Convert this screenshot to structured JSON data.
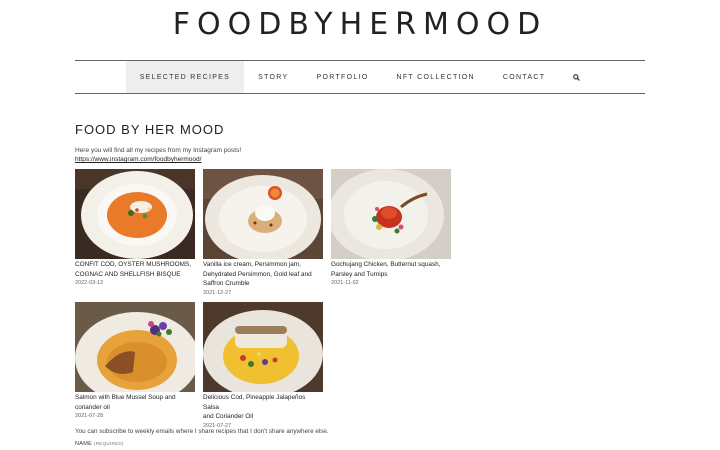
{
  "site": {
    "title": "FOODBYHERMOOD"
  },
  "nav": {
    "items": [
      {
        "label": "SELECTED RECIPES"
      },
      {
        "label": "STORY"
      },
      {
        "label": "PORTFOLIO"
      },
      {
        "label": "NFT COLLECTION"
      },
      {
        "label": "CONTACT"
      }
    ],
    "search_icon": "search-icon"
  },
  "main": {
    "heading": "FOOD BY HER MOOD",
    "intro": "Here you will find all my recipes from my Instagram posts!",
    "link": "https://www.instagram.com/foodbyhermood/"
  },
  "posts": [
    {
      "title_line1": "CONFIT COD, OYSTER MUSHROOMS,",
      "title_line2": "COGNAC AND SHELLFISH BISQUE",
      "title_line3": "",
      "date": "2022-03-12"
    },
    {
      "title_line1": "Vanilla ice cream, Persimmon jam,",
      "title_line2": "Dehydrated Persimmon, Gold leaf and",
      "title_line3": "Saffron Crumble",
      "date": "2021-12-27"
    },
    {
      "title_line1": "Gochujang Chicken, Butternut squash,",
      "title_line2": "Parsley and Turnips",
      "title_line3": "",
      "date": "2021-11-02"
    },
    {
      "title_line1": "Salmon with Blue Mussel Soup and",
      "title_line2": "coriander oil",
      "title_line3": "",
      "date": "2021-07-28"
    },
    {
      "title_line1": "Delicious Cod, Pineapple Jalapeños Salsa",
      "title_line2": "and Coriander Oil",
      "title_line3": "",
      "date": "2021-07-27"
    }
  ],
  "newsletter": {
    "text": "You can subscribe to weekly emails where I share recipes that I don't share anywhere else.",
    "name_label": "NAME",
    "required": "(REQUIRED)"
  }
}
